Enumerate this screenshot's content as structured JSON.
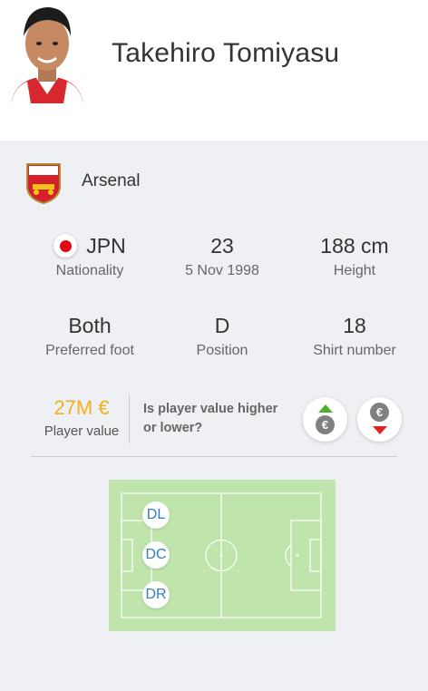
{
  "player": {
    "name": "Takehiro Tomiyasu"
  },
  "club": {
    "name": "Arsenal",
    "crest_text": "Arsenal"
  },
  "stats": {
    "nationality": {
      "value": "JPN",
      "label": "Nationality",
      "flag": "japan-flag"
    },
    "age": {
      "value": "23",
      "label": "5 Nov 1998"
    },
    "height": {
      "value": "188 cm",
      "label": "Height"
    },
    "foot": {
      "value": "Both",
      "label": "Preferred foot"
    },
    "position": {
      "value": "D",
      "label": "Position"
    },
    "shirt": {
      "value": "18",
      "label": "Shirt number"
    }
  },
  "market_value": {
    "amount": "27M €",
    "label": "Player value",
    "question": "Is player value higher or lower?",
    "currency_symbol": "€",
    "higher_icon": "arrow-up-euro-icon",
    "lower_icon": "arrow-down-euro-icon"
  },
  "positions": [
    {
      "label": "DL"
    },
    {
      "label": "DC"
    },
    {
      "label": "DR"
    }
  ],
  "colors": {
    "value_amount": "#f2b11c",
    "pitch": "#bfe5ac",
    "position_text": "#2f80c0",
    "up_arrow": "#4caf30",
    "down_arrow": "#e22323",
    "card_bg": "#eff0f4"
  }
}
